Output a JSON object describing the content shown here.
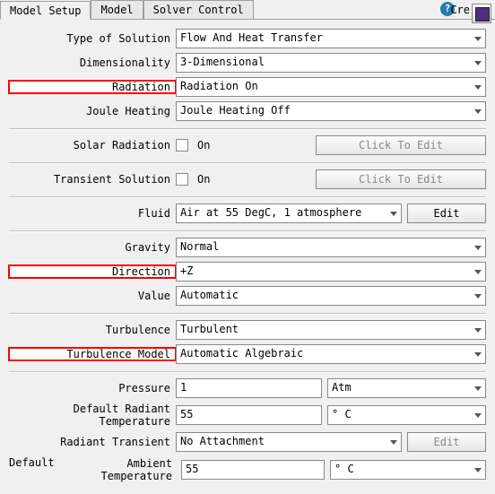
{
  "tabs": {
    "model_setup": "Model Setup",
    "model": "Model",
    "solver_control": "Solver Control",
    "cre": "Cre"
  },
  "help_glyph": "?",
  "labels": {
    "type_of_solution": "Type of Solution",
    "dimensionality": "Dimensionality",
    "radiation": "Radiation",
    "joule_heating": "Joule Heating",
    "solar_radiation": "Solar Radiation",
    "transient_solution": "Transient Solution",
    "fluid": "Fluid",
    "gravity": "Gravity",
    "direction": "Direction",
    "value": "Value",
    "turbulence": "Turbulence",
    "turbulence_model": "Turbulence Model",
    "pressure": "Pressure",
    "default_radiant_temperature": "Default Radiant Temperature",
    "radiant_transient": "Radiant Transient",
    "default": "Default",
    "ambient_temperature": "Ambient Temperature"
  },
  "values": {
    "type_of_solution": "Flow And Heat Transfer",
    "dimensionality": "3-Dimensional",
    "radiation": "Radiation On",
    "joule_heating": "Joule Heating Off",
    "on": "On",
    "click_to_edit": "Click To Edit",
    "fluid": "Air at 55 DegC, 1 atmosphere",
    "edit": "Edit",
    "gravity": "Normal",
    "direction": "+Z",
    "value": "Automatic",
    "turbulence": "Turbulent",
    "turbulence_model": "Automatic Algebraic",
    "pressure": "1",
    "pressure_unit": "Atm",
    "radiant_temp": "55",
    "temp_unit": "° C",
    "radiant_transient": "No Attachment",
    "ambient_temp": "55"
  }
}
